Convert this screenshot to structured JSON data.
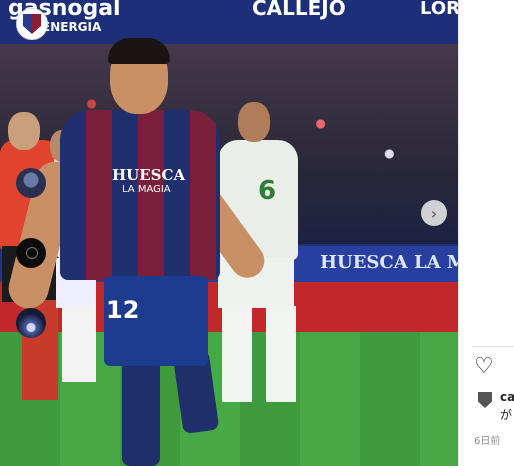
{
  "photo": {
    "ad_top": {
      "brand_left": "gasnogal",
      "brand_left_sub": "ENERGIA",
      "brand_mid": "CALLEJO",
      "brand_right": "LOR"
    },
    "boards": {
      "huesca": "HUESCA LA MA"
    },
    "player_main": {
      "sponsor": "HUESCA",
      "sponsor_sub": "LA MAGIA",
      "number": "12"
    },
    "player_white": {
      "number": "6"
    }
  },
  "navigation": {
    "next_icon": "chevron-right-icon"
  },
  "sidebar": {
    "post_author_icon": "sd-huesca-crest",
    "stories": [
      {
        "icon": "avatar-photo"
      },
      {
        "icon": "avatar-dark-logo"
      },
      {
        "icon": "avatar-night-sky"
      }
    ],
    "like_icon": "heart-icon",
    "comment": {
      "user": "ca",
      "text": "が"
    },
    "timestamp": "6日前"
  }
}
